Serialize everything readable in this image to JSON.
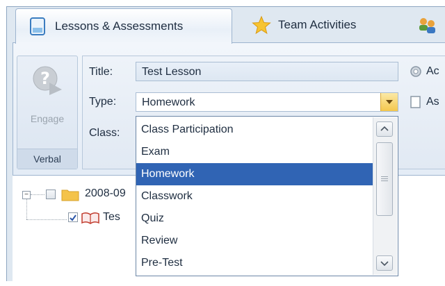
{
  "tabs": [
    {
      "label": "Lessons & Assessments",
      "icon": "document-icon",
      "active": true
    },
    {
      "label": "Team Activities",
      "icon": "star-icon",
      "active": false
    },
    {
      "label": "",
      "icon": "team-icon",
      "active": false
    }
  ],
  "ribbon": {
    "engage": {
      "label": "Engage",
      "icon": "question-speaker-icon",
      "enabled": false
    },
    "group_verbal_label": "Verbal",
    "title_label": "Title:",
    "title_value": "Test Lesson",
    "type_label": "Type:",
    "type_value": "Homework",
    "class_label": "Class:",
    "side_actions": [
      "Ac",
      "As"
    ]
  },
  "dropdown": {
    "options": [
      "Class Participation",
      "Exam",
      "Homework",
      "Classwork",
      "Quiz",
      "Review",
      "Pre-Test"
    ],
    "selected": "Homework"
  },
  "tree": {
    "folder_label": "2008-09",
    "item_label": "Tes"
  },
  "colors": {
    "selection": "#3064b4",
    "ribbon_bg": "#e4ecf6",
    "border": "#9db4cf"
  }
}
